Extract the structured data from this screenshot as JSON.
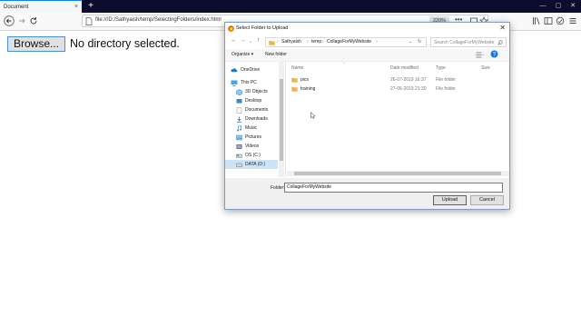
{
  "browser": {
    "tab_title": "Document",
    "tab_close": "×",
    "new_tab": "+",
    "url": "file:///D:/Sathyaish/temp/SelectingFolders/index.html",
    "zoom": "220%",
    "page_actions": "•••",
    "window_controls": {
      "minimize": "—",
      "maximize": "▢",
      "close": "✕"
    }
  },
  "page": {
    "browse_label": "Browse...",
    "status_text": "No directory selected."
  },
  "dialog": {
    "title": "Select Folder to Upload",
    "breadcrumbs": [
      "Sathyaish",
      "temp",
      "CollageForMyWebsite"
    ],
    "search_placeholder": "Search CollageForMyWebsite",
    "organize": "Organize ▾",
    "new_folder": "New folder",
    "nav_items": [
      {
        "label": "OneDrive",
        "icon": "cloud-icon"
      },
      {
        "label": "This PC",
        "icon": "computer-icon"
      },
      {
        "label": "3D Objects",
        "icon": "cube-icon"
      },
      {
        "label": "Desktop",
        "icon": "desktop-icon"
      },
      {
        "label": "Documents",
        "icon": "documents-icon"
      },
      {
        "label": "Downloads",
        "icon": "download-icon"
      },
      {
        "label": "Music",
        "icon": "music-icon"
      },
      {
        "label": "Pictures",
        "icon": "pictures-icon"
      },
      {
        "label": "Videos",
        "icon": "videos-icon"
      },
      {
        "label": "OS (C:)",
        "icon": "drive-icon"
      },
      {
        "label": "DATA (D:)",
        "icon": "drive-icon"
      }
    ],
    "columns": {
      "name": "Name",
      "date": "Date modified",
      "type": "Type",
      "size": "Size"
    },
    "files": [
      {
        "name": "pics",
        "date": "26-07-2019 16:37",
        "type": "File folder"
      },
      {
        "name": "training",
        "date": "27-06-2019 21:30",
        "type": "File folder"
      }
    ],
    "folder_label": "Folder:",
    "folder_value": "CollageForMyWebsite",
    "upload": "Upload",
    "cancel": "Cancel",
    "colors": {
      "accent": "#0078d7",
      "selection": "#cce4f7",
      "folder": "#e8b84a"
    }
  }
}
